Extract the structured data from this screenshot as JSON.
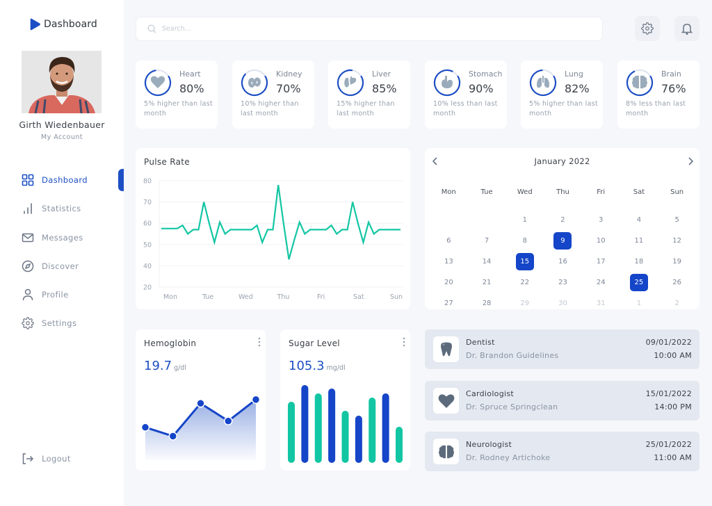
{
  "brand": {
    "title": "Dashboard",
    "color": "#1d4fc4"
  },
  "user": {
    "name": "Girth Wiedenbauer",
    "subtitle": "My Account"
  },
  "sidebar": {
    "items": [
      {
        "label": "Dashboard",
        "icon": "grid-icon",
        "active": true
      },
      {
        "label": "Statistics",
        "icon": "bar-chart-icon",
        "active": false
      },
      {
        "label": "Messages",
        "icon": "mail-icon",
        "active": false
      },
      {
        "label": "Discover",
        "icon": "compass-icon",
        "active": false
      },
      {
        "label": "Profile",
        "icon": "user-icon",
        "active": false
      },
      {
        "label": "Settings",
        "icon": "gear-icon",
        "active": false
      }
    ],
    "logout_label": "Logout"
  },
  "search": {
    "placeholder": "Search...",
    "value": ""
  },
  "header": {
    "settings_icon": "gear-icon",
    "notifications_icon": "bell-icon"
  },
  "organs": [
    {
      "name": "Heart",
      "value": "80%",
      "progress": 0.8,
      "note": "5% higher than last month",
      "icon": "heart-icon"
    },
    {
      "name": "Kidney",
      "value": "70%",
      "progress": 0.7,
      "note": "10% higher than last month",
      "icon": "kidney-icon"
    },
    {
      "name": "Liver",
      "value": "85%",
      "progress": 0.85,
      "note": "15% higher than last month",
      "icon": "liver-icon"
    },
    {
      "name": "Stomach",
      "value": "90%",
      "progress": 0.9,
      "note": "10% less than last month",
      "icon": "stomach-icon"
    },
    {
      "name": "Lung",
      "value": "82%",
      "progress": 0.82,
      "note": "5% higher than last month",
      "icon": "lungs-icon"
    },
    {
      "name": "Brain",
      "value": "76%",
      "progress": 0.76,
      "note": "8% less than last month",
      "icon": "brain-icon"
    }
  ],
  "pulse": {
    "title": "Pulse Rate",
    "color": "#12c6a3",
    "chart_data": {
      "type": "line",
      "title": "Pulse Rate",
      "xlabel": "",
      "ylabel": "",
      "x_ticks": [
        "Mon",
        "Tue",
        "Wed",
        "Thu",
        "Fri",
        "Sat",
        "Sun"
      ],
      "y_ticks": [
        20,
        40,
        50,
        60,
        70,
        80
      ],
      "ylim": [
        20,
        80
      ],
      "grid": true,
      "values": [
        57.5,
        57.5,
        57.5,
        57.5,
        59,
        55,
        57,
        57,
        70,
        60,
        51,
        60.5,
        55,
        57,
        57,
        57,
        57,
        57,
        59,
        51,
        57,
        57,
        78,
        60,
        43,
        52,
        60.5,
        55,
        57,
        57,
        57,
        57,
        59,
        55,
        57,
        57,
        70,
        60,
        51,
        60.5,
        55,
        57,
        57,
        57,
        57,
        57
      ]
    }
  },
  "calendar": {
    "month": "January 2022",
    "weekdays": [
      "Mon",
      "Tue",
      "Wed",
      "Thu",
      "Fri",
      "Sat",
      "Sun"
    ],
    "days": [
      {
        "d": "",
        "m": false
      },
      {
        "d": "",
        "m": false
      },
      {
        "d": "1",
        "m": false
      },
      {
        "d": "2",
        "m": false
      },
      {
        "d": "3",
        "m": false
      },
      {
        "d": "4",
        "m": false
      },
      {
        "d": "5",
        "m": false
      },
      {
        "d": "6",
        "m": false
      },
      {
        "d": "7",
        "m": false
      },
      {
        "d": "8",
        "m": false
      },
      {
        "d": "9",
        "m": false,
        "marked": true
      },
      {
        "d": "10",
        "m": false
      },
      {
        "d": "11",
        "m": false
      },
      {
        "d": "12",
        "m": false
      },
      {
        "d": "13",
        "m": false
      },
      {
        "d": "14",
        "m": false
      },
      {
        "d": "15",
        "m": false,
        "marked": true
      },
      {
        "d": "16",
        "m": false
      },
      {
        "d": "17",
        "m": false
      },
      {
        "d": "18",
        "m": false
      },
      {
        "d": "19",
        "m": false
      },
      {
        "d": "20",
        "m": false
      },
      {
        "d": "21",
        "m": false
      },
      {
        "d": "22",
        "m": false
      },
      {
        "d": "23",
        "m": false
      },
      {
        "d": "24",
        "m": false
      },
      {
        "d": "25",
        "m": false,
        "marked": true
      },
      {
        "d": "26",
        "m": false
      },
      {
        "d": "27",
        "m": false
      },
      {
        "d": "28",
        "m": false
      },
      {
        "d": "29",
        "m": true
      },
      {
        "d": "30",
        "m": true
      },
      {
        "d": "31",
        "m": true
      },
      {
        "d": "1",
        "m": true
      },
      {
        "d": "2",
        "m": true
      }
    ],
    "marked_color": "#1545c8"
  },
  "hemoglobin": {
    "title": "Hemoglobin",
    "value": "19.7",
    "unit": "g/dl",
    "chart_data": {
      "type": "area",
      "values": [
        52,
        38,
        90,
        62,
        96
      ],
      "ylim": [
        0,
        130
      ]
    }
  },
  "sugar": {
    "title": "Sugar Level",
    "value": "105.3",
    "unit": "mg/dl",
    "colors": [
      "#12c6a3",
      "#1545c8"
    ],
    "chart_data": {
      "type": "bar",
      "values": [
        88,
        112,
        100,
        107,
        75,
        68,
        94,
        100,
        52
      ],
      "ylim": [
        0,
        120
      ]
    }
  },
  "appointments": [
    {
      "title": "Dentist",
      "doctor": "Dr. Brandon Guidelines",
      "date": "09/01/2022",
      "time": "10:00 AM",
      "icon": "tooth-icon"
    },
    {
      "title": "Cardiologist",
      "doctor": "Dr. Spruce Springclean",
      "date": "15/01/2022",
      "time": "14:00 PM",
      "icon": "heart-icon"
    },
    {
      "title": "Neurologist",
      "doctor": "Dr. Rodney Artichoke",
      "date": "25/01/2022",
      "time": "11:00 AM",
      "icon": "brain-icon"
    }
  ]
}
